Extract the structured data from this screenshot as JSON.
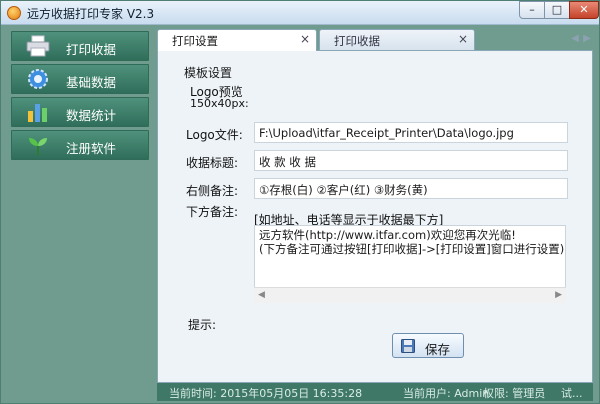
{
  "window": {
    "title": "远方收据打印专家 V2.3"
  },
  "sidebar": {
    "items": [
      {
        "label": "打印收据",
        "icon": "printer-icon"
      },
      {
        "label": "基础数据",
        "icon": "gear-icon"
      },
      {
        "label": "数据统计",
        "icon": "bar-chart-icon"
      },
      {
        "label": "注册软件",
        "icon": "sprout-icon"
      }
    ]
  },
  "tabs": [
    {
      "label": "打印设置",
      "active": true
    },
    {
      "label": "打印收据",
      "active": false
    }
  ],
  "form": {
    "group_title": "模板设置",
    "logo_preview_label": "Logo预览",
    "logo_preview_size": "150x40px:",
    "logo_file_label": "Logo文件:",
    "logo_file_value": "F:\\Upload\\itfar_Receipt_Printer\\Data\\logo.jpg",
    "receipt_title_label": "收据标题:",
    "receipt_title_value": "收 款 收 据",
    "right_note_label": "右侧备注:",
    "right_note_value": "①存根(白)  ②客户(红)  ③财务(黄)",
    "bottom_note_label": "下方备注:",
    "bottom_note_hint": "[如地址、电话等显示于收据最下方]",
    "bottom_note_lines": [
      "远方软件(http://www.itfar.com)欢迎您再次光临!",
      "(下方备注可通过按钮[打印收据]->[打印设置]窗口进行设置)"
    ]
  },
  "hint_label": "提示:",
  "save_button": {
    "label": "保存",
    "icon": "floppy-disk-icon"
  },
  "status": {
    "time": "当前时间: 2015年05月05日  16:35:28",
    "user": "当前用户: Admin",
    "role": "权限: 管理员",
    "mode": "试..."
  },
  "colors": {
    "sidebar_button": "#3f8570",
    "status_bar": "#3f7866",
    "panel_bg": "#eef3f8"
  }
}
